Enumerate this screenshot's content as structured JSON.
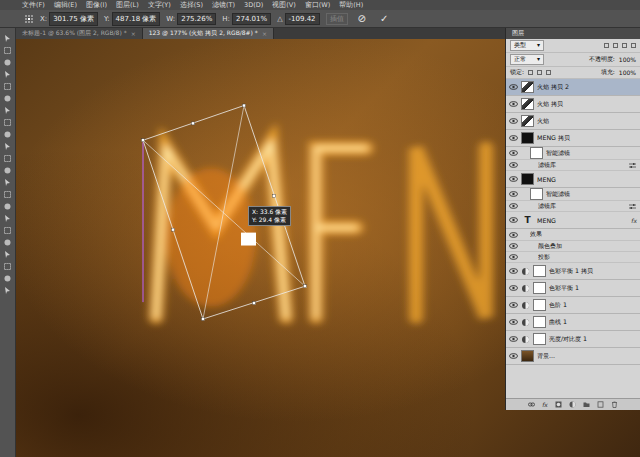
{
  "window": {
    "title": "Photoshop"
  },
  "menu": [
    "文件(F)",
    "编辑(E)",
    "图像(I)",
    "图层(L)",
    "文字(Y)",
    "选择(S)",
    "滤镜(T)",
    "3D(D)",
    "视图(V)",
    "窗口(W)",
    "帮助(H)"
  ],
  "options": {
    "fields": [
      {
        "label": "X:",
        "value": "301.75 像素"
      },
      {
        "label": "Y:",
        "value": "487.18 像素"
      },
      {
        "label": "W:",
        "value": "275.26%"
      },
      {
        "label": "H:",
        "value": "274.01%"
      },
      {
        "label": "△",
        "value": "-109.42"
      }
    ],
    "interpolation": {
      "label": "插值",
      "disabled": true
    },
    "cancel": "⊘",
    "commit": "✓"
  },
  "tabs": [
    {
      "label": "未标题-1 @ 63.6% (图层 2, RGB/8) *",
      "close": "×",
      "selected": false
    },
    {
      "label": "123 @ 177% (火焰 拷贝 2, RGB/8#) *",
      "close": "×",
      "selected": true
    }
  ],
  "canvas": {
    "tooltip": [
      "X: 33.6 像素",
      "Y: 29.4 像素"
    ]
  },
  "layers_panel": {
    "title": "图层",
    "filter": "类型",
    "blend": "正常",
    "opacity_label": "不透明度:",
    "opacity": "100%",
    "lock_label": "锁定:",
    "fill_label": "填充:",
    "fill": "100%",
    "footer_fx": "fx",
    "layers": [
      {
        "name": "火焰 拷贝 2",
        "kind": "pixel",
        "visible": true,
        "selected": true,
        "glyph": "",
        "fx": "",
        "children": []
      },
      {
        "name": "火焰 拷贝",
        "kind": "pixel",
        "visible": true,
        "selected": false,
        "glyph": "",
        "fx": "",
        "children": []
      },
      {
        "name": "火焰",
        "kind": "pixel",
        "visible": true,
        "selected": false,
        "glyph": "",
        "fx": "",
        "children": []
      },
      {
        "name": "MENG 拷贝",
        "kind": "smart",
        "visible": true,
        "selected": false,
        "glyph": "",
        "fx": "",
        "children": [
          {
            "label": "智能滤镜",
            "kind": "filter-header"
          },
          {
            "label": "滤镜库",
            "kind": "filter"
          }
        ]
      },
      {
        "name": "MENG",
        "kind": "smart",
        "visible": true,
        "selected": false,
        "glyph": "",
        "fx": "",
        "children": [
          {
            "label": "智能滤镜",
            "kind": "filter-header"
          },
          {
            "label": "滤镜库",
            "kind": "filter"
          }
        ]
      },
      {
        "name": "MENG",
        "kind": "text",
        "visible": true,
        "selected": false,
        "glyph": "T",
        "fx": "fx",
        "children": [
          {
            "label": "效果",
            "kind": "effects"
          },
          {
            "label": "颜色叠加",
            "kind": "effect"
          },
          {
            "label": "投影",
            "kind": "effect"
          }
        ]
      },
      {
        "name": "色彩平衡 1 拷贝",
        "kind": "adjust",
        "visible": true,
        "selected": false,
        "glyph": "",
        "fx": "",
        "children": []
      },
      {
        "name": "色彩平衡 1",
        "kind": "adjust",
        "visible": true,
        "selected": false,
        "glyph": "",
        "fx": "",
        "children": []
      },
      {
        "name": "色阶 1",
        "kind": "adjust",
        "visible": true,
        "selected": false,
        "glyph": "",
        "fx": "",
        "children": []
      },
      {
        "name": "曲线 1",
        "kind": "adjust",
        "visible": true,
        "selected": false,
        "glyph": "",
        "fx": "",
        "children": []
      },
      {
        "name": "亮度/对比度 1",
        "kind": "adjust",
        "visible": true,
        "selected": false,
        "glyph": "",
        "fx": "",
        "children": []
      },
      {
        "name": "背景...",
        "kind": "background",
        "visible": true,
        "selected": false,
        "glyph": "",
        "fx": "",
        "children": []
      }
    ]
  }
}
